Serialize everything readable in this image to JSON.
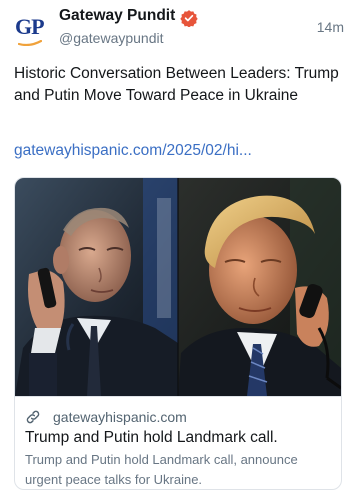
{
  "post": {
    "author": {
      "name": "Gateway Pundit",
      "handle": "@gatewaypundit",
      "avatar_text": "GP",
      "verified": true,
      "avatar_icon": "gp-logo-icon",
      "verified_icon": "verified-badge-icon"
    },
    "time": "14m",
    "text": "Historic Conversation Between Leaders: Trump and Putin Move Toward Peace in Ukraine",
    "link": "gatewayhispanic.com/2025/02/hi...",
    "card": {
      "image_icon": "leaders-phone-call-photo",
      "link_icon": "link-icon",
      "domain": "gatewayhispanic.com",
      "title": "Trump and Putin hold Landmark call.",
      "description": "Trump and Putin hold Landmark call, announce urgent peace talks for Ukraine."
    }
  },
  "colors": {
    "link": "#3b6fc4",
    "verified_badge": "#e7553b",
    "brand_blue": "#1b3a8c",
    "brand_orange": "#f0a23b",
    "secondary_text": "#687684",
    "border": "#dfe3e8"
  }
}
